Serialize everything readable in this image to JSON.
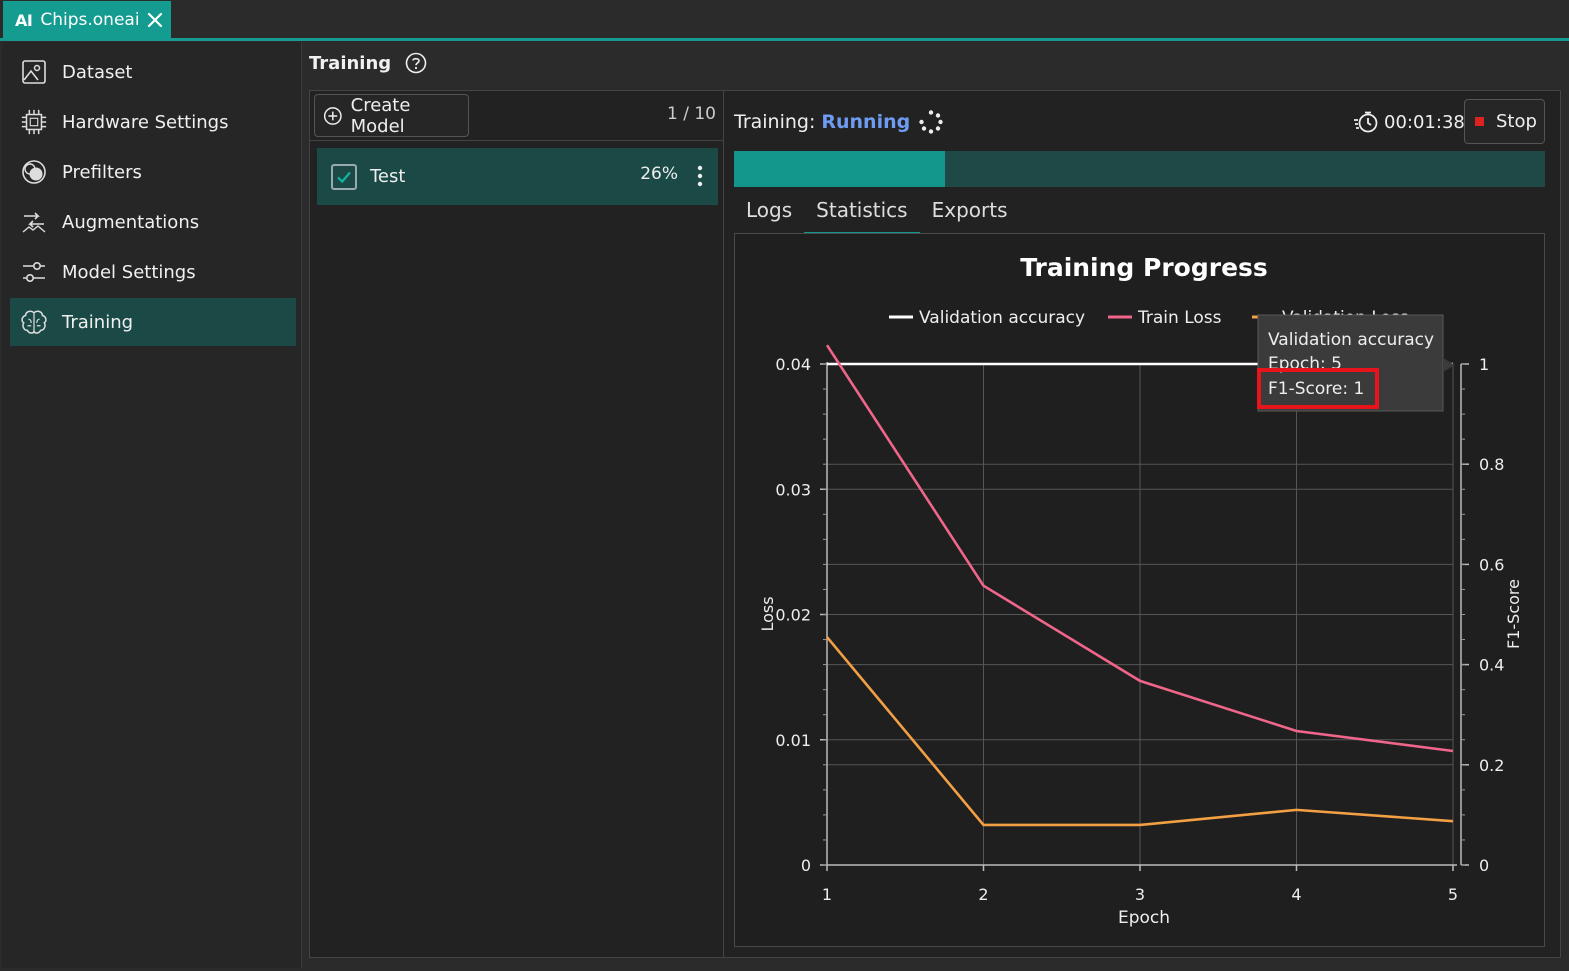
{
  "tab": {
    "logo": "AI",
    "title": "Chips.oneai"
  },
  "sidebar": {
    "items": [
      {
        "label": "Dataset",
        "icon": "image-icon"
      },
      {
        "label": "Hardware Settings",
        "icon": "chip-icon"
      },
      {
        "label": "Prefilters",
        "icon": "filter-circles-icon"
      },
      {
        "label": "Augmentations",
        "icon": "augment-icon"
      },
      {
        "label": "Model Settings",
        "icon": "sliders-icon"
      },
      {
        "label": "Training",
        "icon": "brain-icon"
      }
    ],
    "active_index": 5
  },
  "main": {
    "title": "Training"
  },
  "models": {
    "create_label": "Create Model",
    "page_count": "1 / 10",
    "items": [
      {
        "name": "Test",
        "progress_label": "26%",
        "checked": true
      }
    ]
  },
  "training": {
    "status_label": "Training:",
    "status_value": "Running",
    "elapsed": "00:01:38",
    "stop_label": "Stop",
    "progress_fraction": 0.26
  },
  "result_tabs": [
    {
      "label": "Logs",
      "active": false
    },
    {
      "label": "Statistics",
      "active": true
    },
    {
      "label": "Exports",
      "active": false
    }
  ],
  "colors": {
    "accent": "#139c8f",
    "running": "#6e9cf2",
    "train_loss": "#f0668a",
    "val_loss": "#f2a043",
    "val_acc": "#ffffff",
    "highlight": "#e8141c"
  },
  "chart_data": {
    "type": "line",
    "title": "Training Progress",
    "xlabel": "Epoch",
    "ylabel": "Loss",
    "ylabel_right": "F1-Score",
    "x": [
      1,
      2,
      3,
      4,
      5
    ],
    "x_ticks": [
      "1",
      "2",
      "3",
      "4",
      "5"
    ],
    "ylim": [
      0,
      0.04
    ],
    "y_ticks": [
      "0",
      "0.01",
      "0.02",
      "0.03",
      "0.04"
    ],
    "ylim_right": [
      0,
      1
    ],
    "y_right_ticks": [
      "0",
      "0.2",
      "0.4",
      "0.6",
      "0.8",
      "1"
    ],
    "series": [
      {
        "name": "Validation accuracy",
        "axis": "right",
        "values": [
          1,
          1,
          1,
          1,
          1
        ]
      },
      {
        "name": "Train Loss",
        "axis": "left",
        "values": [
          0.0415,
          0.0223,
          0.0147,
          0.0107,
          0.0091
        ]
      },
      {
        "name": "Validation Loss",
        "axis": "left",
        "values": [
          0.0182,
          0.0032,
          0.0032,
          0.0044,
          0.0035
        ]
      }
    ],
    "legend_position": "top",
    "grid": true,
    "tooltip": {
      "series": "Validation accuracy",
      "epoch_line": "Epoch: 5",
      "value_line": "F1-Score: 1"
    }
  }
}
